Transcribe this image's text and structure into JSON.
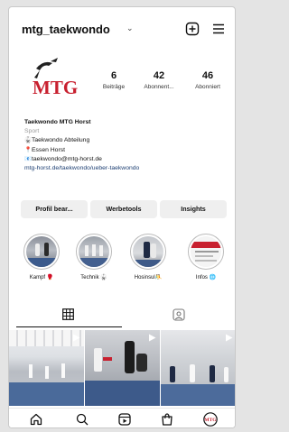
{
  "header": {
    "username": "mtg_taekwondo",
    "chevron": "⌄",
    "icons": [
      "add-icon",
      "menu-icon"
    ]
  },
  "profile": {
    "logo_text": "MTG",
    "stats": [
      {
        "value": "6",
        "label": "Beiträge"
      },
      {
        "value": "42",
        "label": "Abonnent..."
      },
      {
        "value": "46",
        "label": "Abonniert"
      }
    ]
  },
  "bio": {
    "name": "Taekwondo MTG Horst",
    "category": "Sport",
    "line1": "Taekwondo Abteilung",
    "line2": "Essen Horst",
    "line3": "taekwondo@mtg-horst.de",
    "link": "mtg-horst.de/taekwondo/ueber-taekwondo",
    "line_icons": [
      "taekwondo-emoji-icon",
      "pin-icon",
      "mail-icon"
    ]
  },
  "buttons": [
    "Profil bear...",
    "Werbetools",
    "Insights"
  ],
  "highlights": [
    {
      "label": "Kampf 🥊"
    },
    {
      "label": "Technik 🥋"
    },
    {
      "label": "Hosinsul🤼"
    },
    {
      "label": "Infos 🌐"
    }
  ],
  "tabs": {
    "active": "grid",
    "icons": [
      "grid-icon",
      "tagged-icon"
    ]
  },
  "posts": [
    {
      "type": "reel",
      "icon": "reel-icon"
    },
    {
      "type": "reel",
      "icon": "reel-icon"
    },
    {
      "type": "reel",
      "icon": "reel-icon"
    }
  ],
  "nav": [
    "home-icon",
    "search-icon",
    "reels-icon",
    "shop-icon",
    "profile-avatar"
  ],
  "colors": {
    "brand_red": "#c8202f",
    "link": "#1d3f73",
    "muted": "#9a9a9a",
    "button_bg": "#efefef"
  }
}
